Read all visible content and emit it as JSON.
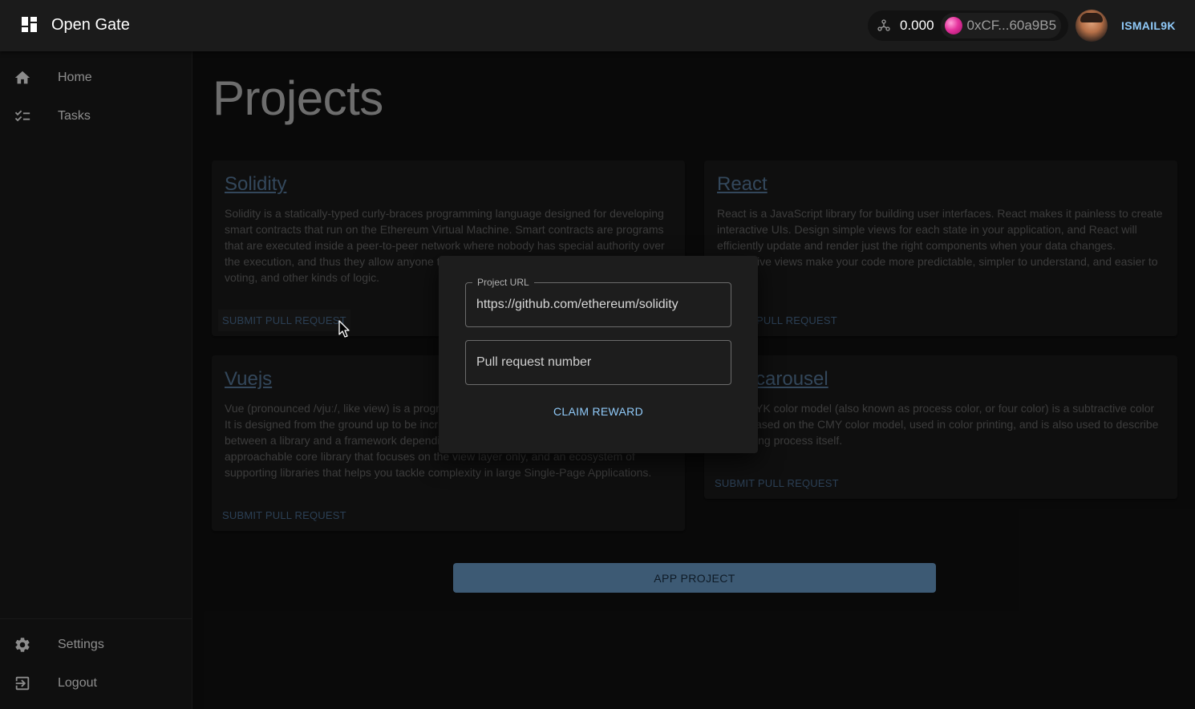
{
  "appbar": {
    "title": "Open Gate",
    "balance": "0.000",
    "address": "0xCF...60a9B5",
    "username": "ISMAIL9K"
  },
  "sidebar": {
    "items": [
      {
        "label": "Home",
        "icon": "home-icon"
      },
      {
        "label": "Tasks",
        "icon": "checklist-icon"
      }
    ],
    "bottom_items": [
      {
        "label": "Settings",
        "icon": "gear-icon"
      },
      {
        "label": "Logout",
        "icon": "logout-icon"
      }
    ]
  },
  "main": {
    "page_title": "Projects",
    "projects": [
      {
        "title": "Solidity",
        "description": "Solidity is a statically-typed curly-braces programming language designed for developing smart contracts that run on the Ethereum Virtual Machine. Smart contracts are programs that are executed inside a peer-to-peer network where nobody has special authority over the execution, and thus they allow anyone t",
        "description_end": "voting, and other kinds of logic.",
        "action": "SUBMIT PULL REQUEST"
      },
      {
        "title": "React",
        "description": "React is a JavaScript library for building user interfaces. React makes it painless to create interactive UIs. Design simple views for each state in your application, and React will efficiently update and render just the right components when your data changes.",
        "description_end": "ive views make your code more predictable, simpler to understand, and easier to",
        "action": "PULL REQUEST"
      },
      {
        "title": "Vuejs",
        "description": "Vue (pronounced /vjuː/, like view) is a progr",
        "description_line2": "It is designed from the ground up to be incr",
        "description_line3": "between a library and a framework dependi",
        "description_line4": "approachable core library that focuses on the view layer only, and an ecosystem of",
        "description_line5": "supporting libraries that helps you tackle complexity in large Single-Page Applications.",
        "action": "SUBMIT PULL REQUEST"
      },
      {
        "title": "carousel",
        "description_line1": "YK color model (also known as process color, or four color) is a subtractive color",
        "description_line2": "ased on the CMY color model, used in color printing, and is also used to describe",
        "description_line3": "ing process itself.",
        "action": "SUBMIT PULL REQUEST"
      }
    ],
    "add_button": "APP PROJECT"
  },
  "dialog": {
    "url_label": "Project URL",
    "url_value": "https://github.com/ethereum/solidity",
    "pr_placeholder": "Pull request number",
    "claim_label": "CLAIM REWARD"
  },
  "colors": {
    "accent": "#90caf9",
    "button_bg": "#3d5a74",
    "link": "#5d82a6"
  }
}
